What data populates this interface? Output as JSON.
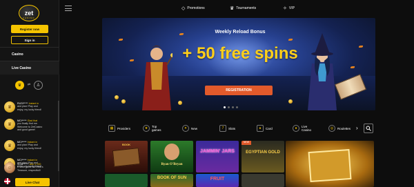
{
  "sidebar": {
    "logo_text": "zet",
    "logo_sub": "CASINO",
    "register_label": "Register now",
    "signin_label": "Sign in",
    "nav": [
      {
        "label": "Casino"
      },
      {
        "label": "Live Casino"
      }
    ],
    "wins": [
      {
        "name": "RUSI*****",
        "line1": "Instant in",
        "line2": "and plan! Play and",
        "line3": "enjoy, my lucky friend!"
      },
      {
        "name": "MCI*****",
        "line1": "Glad that",
        "line2": "you finally find me.",
        "line3": "Welcome to ZetCasino",
        "line4": "and good game!"
      },
      {
        "name": "MCI*****",
        "line1": "Instant in",
        "line2": "and plan! Play and",
        "line3": "enjoy, my lucky friend!"
      },
      {
        "name": "MCI*****",
        "line1": "Instant in",
        "line2": "and plan! Play and",
        "line3": "enjoy, my lucky friend!"
      },
      {
        "name": "SCAP*****",
        "line1": "won 1 000",
        "line2": "€ 10 in game Da Vinci's",
        "line3": "Treasure, respectfull!"
      }
    ],
    "live_chat_label": "Live Chat"
  },
  "topnav": {
    "items": [
      {
        "label": "Promotions",
        "icon": "diamond-icon"
      },
      {
        "label": "Tournaments",
        "icon": "crown-icon"
      },
      {
        "label": "VIP",
        "icon": "gem-icon"
      }
    ]
  },
  "banner": {
    "title": "Weekly Reload Bonus",
    "headline": "+ 50 free spins",
    "button_label": "REGISTRATION",
    "active_slide": 1,
    "slide_count": 4
  },
  "categories": [
    {
      "label": "Providers"
    },
    {
      "label": "Top games"
    },
    {
      "label": "New"
    },
    {
      "label": "Slots"
    },
    {
      "label": "Card"
    },
    {
      "label": "Live Casino"
    },
    {
      "label": "Roulettes"
    }
  ],
  "games": [
    {
      "title": "BOOK"
    },
    {
      "title": "Ryan O'Bryan"
    },
    {
      "title": "JAMMIN' JARS"
    },
    {
      "title": "EGYPTIAN GOLD"
    },
    {
      "title": ""
    },
    {
      "title": "BOOK OF SUN"
    },
    {
      "title": "FRUIT"
    }
  ],
  "colors": {
    "accent": "#f5c400",
    "cta": "#e25a2b",
    "headline": "#ffcf1a",
    "background": "#0d0d0d"
  }
}
